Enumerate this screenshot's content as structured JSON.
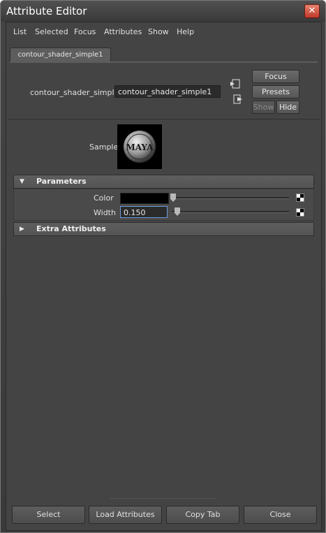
{
  "window": {
    "title": "Attribute Editor",
    "close_glyph": "✕"
  },
  "menu": [
    "List",
    "Selected",
    "Focus",
    "Attributes",
    "Show",
    "Help"
  ],
  "tab": {
    "label": "contour_shader_simple1"
  },
  "node": {
    "type_label": "contour_shader_simple:",
    "name": "contour_shader_simple1"
  },
  "side_buttons": {
    "focus": "Focus",
    "presets": "Presets",
    "show": "Show",
    "hide": "Hide"
  },
  "sample": {
    "label": "Sample",
    "logo_text": "MAYA"
  },
  "parameters": {
    "header": "Parameters",
    "color_label": "Color",
    "color_value": "#000000",
    "width_label": "Width",
    "width_value": "0.150"
  },
  "extra": {
    "header": "Extra Attributes"
  },
  "footer": {
    "select": "Select",
    "load": "Load Attributes",
    "copy": "Copy Tab",
    "close": "Close"
  }
}
